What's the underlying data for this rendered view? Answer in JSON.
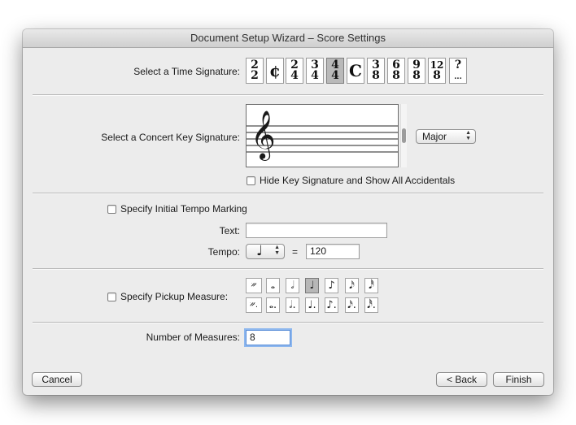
{
  "window": {
    "title": "Document Setup Wizard – Score Settings"
  },
  "time_signature": {
    "label": "Select a Time Signature:",
    "options": [
      {
        "top": "2",
        "bottom": "2"
      },
      {
        "symbol": "¢"
      },
      {
        "top": "2",
        "bottom": "4"
      },
      {
        "top": "3",
        "bottom": "4"
      },
      {
        "top": "4",
        "bottom": "4"
      },
      {
        "symbol": "C"
      },
      {
        "top": "3",
        "bottom": "8"
      },
      {
        "top": "6",
        "bottom": "8"
      },
      {
        "top": "9",
        "bottom": "8"
      },
      {
        "top": "12",
        "bottom": "8"
      },
      {
        "top": "?",
        "bottom": "..."
      }
    ],
    "selected_index": 4
  },
  "key_signature": {
    "label": "Select a Concert Key Signature:",
    "clef_glyph": "𝄞",
    "mode": "Major",
    "hide_label": "Hide Key Signature and Show All Accidentals"
  },
  "tempo": {
    "checkbox_label": "Specify Initial Tempo Marking",
    "text_label": "Text:",
    "text_value": "",
    "tempo_label": "Tempo:",
    "note_glyph": "♩",
    "equals": "=",
    "value": "120"
  },
  "pickup": {
    "label": "Specify Pickup Measure:",
    "row1": [
      "𝄏",
      "𝅝",
      "𝅗𝅥",
      "♩",
      "♪",
      "𝅘𝅥𝅯",
      "𝅘𝅥𝅰"
    ],
    "row2": [
      "𝄏.",
      "𝅝.",
      "𝅗𝅥.",
      "♩.",
      "♪.",
      "𝅘𝅥𝅯.",
      "𝅘𝅥𝅰."
    ],
    "selected_row1_index": 3
  },
  "measures": {
    "label": "Number of Measures:",
    "value": "8"
  },
  "buttons": {
    "cancel": "Cancel",
    "back": "< Back",
    "finish": "Finish"
  }
}
